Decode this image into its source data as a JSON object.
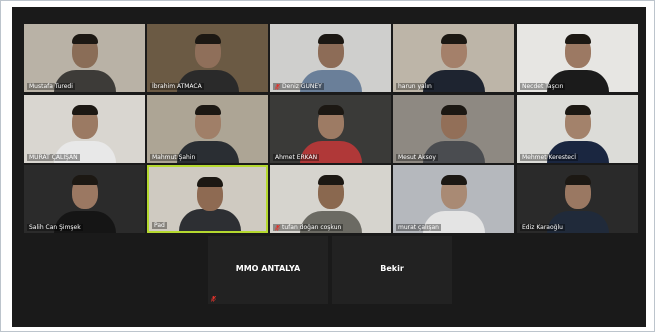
{
  "participants": [
    {
      "name": "Mustafa Turedi",
      "muted": false,
      "bg": "#b9b2a6",
      "face": "#8a6d57",
      "shirt": "#3d3b38"
    },
    {
      "name": "İbrahim ATMACA",
      "muted": false,
      "bg": "#6b5a44",
      "face": "#8f6f5a",
      "shirt": "#2a2a2a"
    },
    {
      "name": "Deniz GUNEY",
      "muted": true,
      "bg": "#cfcfcd",
      "face": "#8d6c57",
      "shirt": "#6a7f99"
    },
    {
      "name": "harun yalın",
      "muted": false,
      "bg": "#bdb5a8",
      "face": "#a4806a",
      "shirt": "#1e2430"
    },
    {
      "name": "Necdet Taşcın",
      "muted": false,
      "bg": "#e7e6e3",
      "face": "#9c7963",
      "shirt": "#1b1b1b"
    },
    {
      "name": "MURAT ÇALIŞAN",
      "muted": false,
      "bg": "#d9d6d0",
      "face": "#9b7a63",
      "shirt": "#e8e8e8"
    },
    {
      "name": "Mahmut Şahin",
      "muted": false,
      "bg": "#ada595",
      "face": "#a07f68",
      "shirt": "#2a2e33"
    },
    {
      "name": "Ahmet ERKAN",
      "muted": false,
      "bg": "#3a3a38",
      "face": "#9d7b64",
      "shirt": "#b03838"
    },
    {
      "name": "Mesut Aksoy",
      "muted": false,
      "bg": "#8e8982",
      "face": "#926f58",
      "shirt": "#4a4c50"
    },
    {
      "name": "Mehmet Kerestecİ",
      "muted": false,
      "bg": "#dcdcd8",
      "face": "#a3826b",
      "shirt": "#1a2640"
    },
    {
      "name": "Salih Can Şimşek",
      "muted": false,
      "bg": "#2b2b2b",
      "face": "#9b7862",
      "shirt": "#151515"
    },
    {
      "name": "Pad",
      "muted": false,
      "bg": "#cfcac1",
      "face": "#8e6a52",
      "shirt": "#2d2f33",
      "speaking": true
    },
    {
      "name": "tufan doğan coşkun",
      "muted": true,
      "bg": "#d6d4ce",
      "face": "#8a684f",
      "shirt": "#6b6a63"
    },
    {
      "name": "murat çalışan",
      "muted": false,
      "bg": "#b5b8bd",
      "face": "#a98a74",
      "shirt": "#e4e4e4"
    },
    {
      "name": "Ediz Karaoğlu",
      "muted": false,
      "bg": "#2a2a2a",
      "face": "#9a7862",
      "shirt": "#202a3a"
    }
  ],
  "audio_only": [
    {
      "name": "MMO ANTALYA",
      "muted": true
    },
    {
      "name": "Bekir",
      "muted": false
    }
  ],
  "colors": {
    "active_speaker": "#b5d92f",
    "mute": "#e0332b",
    "background": "#1a1a1a"
  }
}
